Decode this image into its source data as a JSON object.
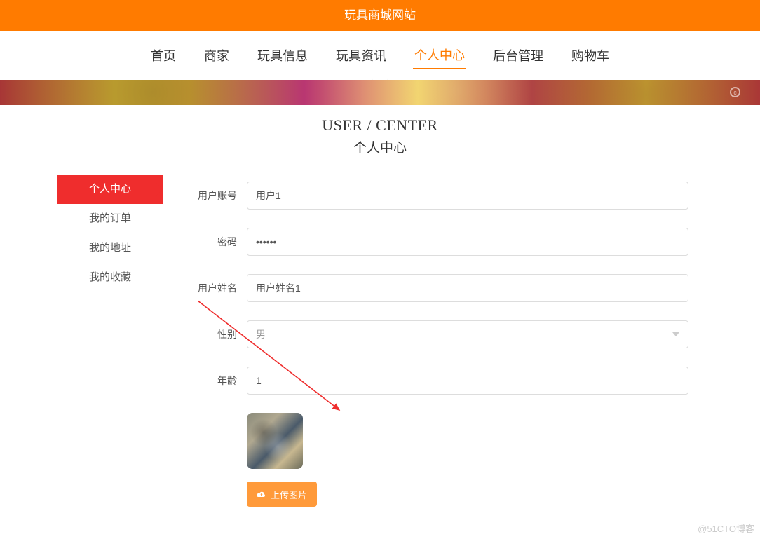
{
  "header": {
    "site_title": "玩具商城网站"
  },
  "nav": {
    "items": [
      {
        "label": "首页",
        "active": false
      },
      {
        "label": "商家",
        "active": false
      },
      {
        "label": "玩具信息",
        "active": false
      },
      {
        "label": "玩具资讯",
        "active": false
      },
      {
        "label": "个人中心",
        "active": true
      },
      {
        "label": "后台管理",
        "active": false
      },
      {
        "label": "购物车",
        "active": false
      }
    ]
  },
  "page": {
    "title_en": "USER / CENTER",
    "title_cn": "个人中心"
  },
  "sidebar": {
    "items": [
      {
        "label": "个人中心",
        "active": true
      },
      {
        "label": "我的订单",
        "active": false
      },
      {
        "label": "我的地址",
        "active": false
      },
      {
        "label": "我的收藏",
        "active": false
      }
    ]
  },
  "form": {
    "username": {
      "label": "用户账号",
      "value": "用户1"
    },
    "password": {
      "label": "密码",
      "value": "••••••"
    },
    "realname": {
      "label": "用户姓名",
      "value": "用户姓名1"
    },
    "gender": {
      "label": "性别",
      "value": "男"
    },
    "age": {
      "label": "年龄",
      "value": "1"
    },
    "upload_label": "上传图片"
  },
  "watermark": "@51CTO博客"
}
